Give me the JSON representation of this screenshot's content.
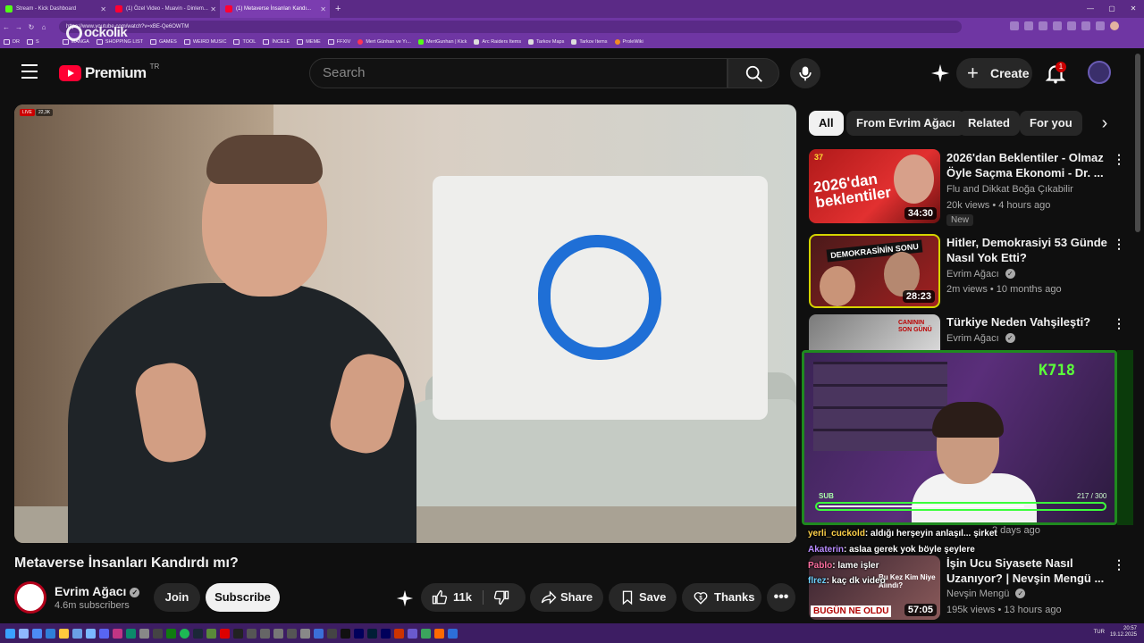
{
  "browser": {
    "tabs": [
      {
        "label": "Stream - Kick Dashboard",
        "icon": "kick-icon"
      },
      {
        "label": "(1) Özel Video - Muavin - Dinlem...",
        "icon": "youtube-icon"
      },
      {
        "label": "(1) Metaverse İnsanları Kandı...",
        "icon": "youtube-icon",
        "active": true
      }
    ],
    "url": "https://www.youtube.com/watch?v=xBE-Qe6OWTM",
    "watermark": "ockolik",
    "bookmarks": [
      "DR",
      "S",
      "MANGA",
      "SHOPPING LIST",
      "GAMES",
      "WEIRD MUSIC",
      "TOOL",
      "İNCELE",
      "MEME",
      "FFXIV",
      "Mert Günhan ve Yı...",
      "MertGunhan | Kick",
      "Arc Raiders Items",
      "Tarkov Maps",
      "Tarkov Items",
      "ProleWiki"
    ]
  },
  "youtube": {
    "logo_text": "Premium",
    "country_code": "TR",
    "search_placeholder": "Search",
    "create_label": "Create",
    "notification_count": "1"
  },
  "video": {
    "live_label": "LIVE",
    "viewer_count": "22,3K",
    "title": "Metaverse İnsanları Kandırdı mı?",
    "channel": "Evrim Ağacı",
    "subscribers": "4.6m subscribers",
    "join_label": "Join",
    "subscribe_label": "Subscribe",
    "likes": "11k",
    "share_label": "Share",
    "save_label": "Save",
    "thanks_label": "Thanks"
  },
  "chips": [
    "All",
    "From Evrim Ağacı",
    "Related",
    "For you"
  ],
  "recommendations": [
    {
      "title": "2026'dan Beklentiler - Olmaz Öyle Saçma Ekonomi - Dr. ...",
      "channel": "Flu and Dikkat Boğa Çıkabilir",
      "meta": "20k views • 4 hours ago",
      "duration": "34:30",
      "badge": "New",
      "thumb_text": "2026'dan beklentiler",
      "thumb_number": "37"
    },
    {
      "title": "Hitler, Demokrasiyi 53 Günde Nasıl Yok Etti?",
      "channel": "Evrim Ağacı",
      "meta": "2m views • 10 months ago",
      "duration": "28:23",
      "thumb_text": "DEMOKRASİNİN SONU"
    },
    {
      "title": "Türkiye Neden Vahşileşti?",
      "channel": "Evrim Ağacı",
      "thumb_text": "CANININ SON GÜNÜ"
    },
    {
      "title": "İşin Ucu Siyasete Nasıl Uzanıyor? | Nevşin Mengü ...",
      "channel": "Nevşin Mengü",
      "meta": "195k views • 13 hours ago",
      "duration": "57:05",
      "thumb_text": "BUGÜN NE OLDU"
    }
  ],
  "hidden_meta": "2 days ago",
  "stream_overlay": {
    "title": "K718",
    "sub_label": "SUB",
    "sub_current": 217,
    "sub_goal": 300,
    "sub_text": "217 / 300"
  },
  "chat": [
    {
      "user": "yerli_cuckold",
      "message": ": aldığı herşeyin anlaşıl... şirket"
    },
    {
      "user": "Akaterin",
      "message": ": aslaa gerek yok böyle şeylere"
    },
    {
      "user": "Pablo",
      "message": ": lame işler"
    },
    {
      "user": "flrez",
      "message": ": kaç dk video"
    }
  ],
  "chat_banner": "Bu Kez Kim Niye Alındı?",
  "tray": {
    "lang": "TUR",
    "time": "20:57",
    "date": "19.12.2025"
  }
}
